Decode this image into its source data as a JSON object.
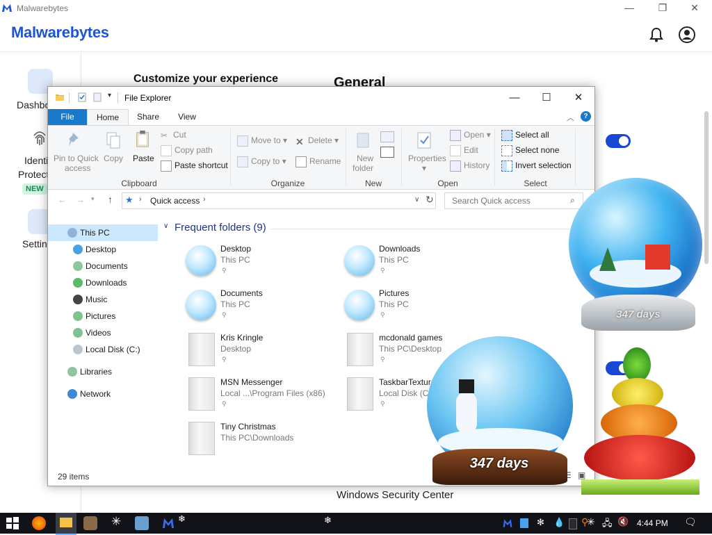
{
  "malwarebytes": {
    "window_title": "Malwarebytes",
    "logo_text": "Malwarebytes",
    "sidebar": {
      "dashboard": "Dashbo",
      "identity_line1": "Identi",
      "identity_line2": "Protect",
      "new_badge": "NEW",
      "settings": "Settin"
    },
    "customize_heading": "Customize your experience",
    "general_heading": "General",
    "windows_security_center": "Windows Security Center"
  },
  "explorer": {
    "title": "File Explorer",
    "tabs": {
      "file": "File",
      "home": "Home",
      "share": "Share",
      "view": "View"
    },
    "ribbon": {
      "clipboard": {
        "label": "Clipboard",
        "pin_line1": "Pin to Quick",
        "pin_line2": "access",
        "copy": "Copy",
        "paste": "Paste",
        "cut": "Cut",
        "copy_path": "Copy path",
        "paste_shortcut": "Paste shortcut"
      },
      "organize": {
        "label": "Organize",
        "move_to": "Move to",
        "copy_to": "Copy to",
        "delete": "Delete",
        "rename": "Rename"
      },
      "new": {
        "label": "New",
        "new_folder_line1": "New",
        "new_folder_line2": "folder"
      },
      "open": {
        "label": "Open",
        "properties": "Properties",
        "open": "Open",
        "edit": "Edit",
        "history": "History"
      },
      "select": {
        "label": "Select",
        "select_all": "Select all",
        "select_none": "Select none",
        "invert_selection": "Invert selection"
      }
    },
    "address": {
      "path": "Quick access",
      "search_placeholder": "Search Quick access"
    },
    "nav": {
      "this_pc": "This PC",
      "desktop": "Desktop",
      "documents": "Documents",
      "downloads": "Downloads",
      "music": "Music",
      "pictures": "Pictures",
      "videos": "Videos",
      "local_disk": "Local Disk (C:)",
      "libraries": "Libraries",
      "network": "Network"
    },
    "section_heading": "Frequent folders (9)",
    "folders": [
      {
        "name": "Desktop",
        "path": "This PC"
      },
      {
        "name": "Downloads",
        "path": "This PC"
      },
      {
        "name": "Documents",
        "path": "This PC"
      },
      {
        "name": "Pictures",
        "path": "This PC"
      },
      {
        "name": "Kris Kringle",
        "path": "Desktop"
      },
      {
        "name": "mcdonald games",
        "path": "This PC\\Desktop"
      },
      {
        "name": "MSN Messenger",
        "path": "Local ...\\Program Files (x86)"
      },
      {
        "name": "TaskbarTexture",
        "path": "Local Disk (C:)"
      },
      {
        "name": "Tiny Christmas",
        "path": "This PC\\Downloads"
      }
    ],
    "status": "29 items"
  },
  "gadgets": {
    "globe_small_days": "347 days",
    "globe_large_days": "347 days"
  },
  "taskbar": {
    "time": "4:44 PM"
  },
  "colors": {
    "accent_blue": "#1979ca",
    "malwarebytes_blue": "#1f55d1",
    "toggle_blue": "#1747d3",
    "taskbar": "#111318"
  }
}
